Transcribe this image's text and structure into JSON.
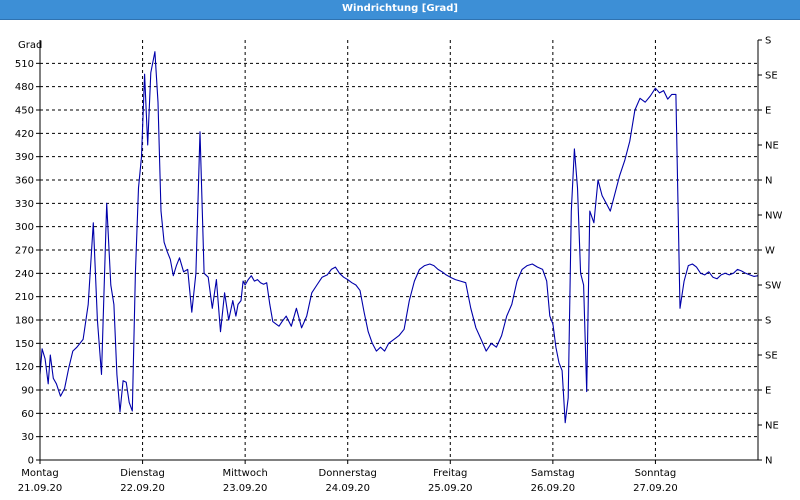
{
  "window": {
    "title": "Windrichtung [Grad]"
  },
  "chart_data": {
    "type": "line",
    "title": "Windrichtung [Grad]",
    "ylabel": "Grad",
    "ylim": [
      0,
      540
    ],
    "xlim": [
      0,
      7
    ],
    "grid": true,
    "y_ticks": [
      0,
      30,
      60,
      90,
      120,
      150,
      180,
      210,
      240,
      270,
      300,
      330,
      360,
      390,
      420,
      450,
      480,
      510
    ],
    "right_ticks": [
      {
        "v": 0,
        "label": "N"
      },
      {
        "v": 45,
        "label": "NE"
      },
      {
        "v": 90,
        "label": "E"
      },
      {
        "v": 135,
        "label": "SE"
      },
      {
        "v": 180,
        "label": "S"
      },
      {
        "v": 225,
        "label": "SW"
      },
      {
        "v": 270,
        "label": "W"
      },
      {
        "v": 315,
        "label": "NW"
      },
      {
        "v": 360,
        "label": "N"
      },
      {
        "v": 405,
        "label": "NE"
      },
      {
        "v": 450,
        "label": "E"
      },
      {
        "v": 495,
        "label": "SE"
      },
      {
        "v": 540,
        "label": "S"
      }
    ],
    "x_ticks": [
      {
        "day": "Montag",
        "date": "21.09.20",
        "x": 0
      },
      {
        "day": "Dienstag",
        "date": "22.09.20",
        "x": 1
      },
      {
        "day": "Mittwoch",
        "date": "23.09.20",
        "x": 2
      },
      {
        "day": "Donnerstag",
        "date": "24.09.20",
        "x": 3
      },
      {
        "day": "Freitag",
        "date": "25.09.20",
        "x": 4
      },
      {
        "day": "Samstag",
        "date": "26.09.20",
        "x": 5
      },
      {
        "day": "Sonntag",
        "date": "27.09.20",
        "x": 6
      }
    ],
    "colors": {
      "line": "#0000aa",
      "grid": "#000000",
      "axis": "#000000"
    },
    "series": [
      {
        "x": [
          0.0,
          0.02,
          0.05,
          0.08,
          0.1,
          0.13,
          0.16,
          0.2,
          0.24,
          0.28,
          0.32,
          0.36,
          0.42,
          0.47,
          0.52,
          0.56,
          0.6,
          0.65,
          0.69,
          0.72,
          0.75,
          0.78,
          0.81,
          0.84,
          0.87,
          0.9,
          0.93,
          0.96,
          0.99,
          1.02,
          1.05,
          1.08,
          1.12,
          1.15,
          1.18,
          1.21,
          1.24,
          1.27,
          1.3,
          1.33,
          1.36,
          1.4,
          1.44,
          1.48,
          1.52,
          1.56,
          1.6,
          1.64,
          1.68,
          1.72,
          1.76,
          1.8,
          1.84,
          1.88,
          1.91,
          1.93,
          1.96,
          1.98,
          2.0,
          2.03,
          2.06,
          2.09,
          2.12,
          2.15,
          2.18,
          2.21,
          2.24,
          2.27,
          2.3,
          2.33,
          2.36,
          2.4,
          2.45,
          2.5,
          2.55,
          2.6,
          2.65,
          2.7,
          2.75,
          2.8,
          2.84,
          2.88,
          2.92,
          2.96,
          3.0,
          3.04,
          3.08,
          3.12,
          3.16,
          3.2,
          3.24,
          3.28,
          3.32,
          3.36,
          3.4,
          3.45,
          3.5,
          3.55,
          3.6,
          3.65,
          3.7,
          3.75,
          3.8,
          3.84,
          3.88,
          3.92,
          3.96,
          4.0,
          4.05,
          4.1,
          4.15,
          4.2,
          4.25,
          4.3,
          4.35,
          4.4,
          4.45,
          4.5,
          4.55,
          4.6,
          4.65,
          4.7,
          4.75,
          4.8,
          4.85,
          4.9,
          4.94,
          4.97,
          5.0,
          5.03,
          5.06,
          5.09,
          5.12,
          5.15,
          5.18,
          5.21,
          5.24,
          5.27,
          5.3,
          5.33,
          5.36,
          5.4,
          5.44,
          5.48,
          5.52,
          5.56,
          5.6,
          5.65,
          5.7,
          5.75,
          5.8,
          5.85,
          5.9,
          5.95,
          6.0,
          6.04,
          6.08,
          6.12,
          6.16,
          6.2,
          6.24,
          6.28,
          6.32,
          6.36,
          6.4,
          6.44,
          6.48,
          6.52,
          6.56,
          6.6,
          6.64,
          6.68,
          6.72,
          6.76,
          6.8,
          6.84,
          6.88,
          6.92,
          6.96,
          7.0
        ],
        "values": [
          110,
          143,
          130,
          98,
          135,
          105,
          98,
          82,
          92,
          118,
          140,
          145,
          155,
          200,
          305,
          180,
          110,
          330,
          225,
          200,
          110,
          62,
          102,
          100,
          74,
          63,
          240,
          350,
          390,
          496,
          405,
          498,
          525,
          460,
          320,
          280,
          268,
          258,
          237,
          250,
          260,
          242,
          245,
          190,
          240,
          422,
          240,
          235,
          195,
          232,
          165,
          215,
          180,
          205,
          185,
          200,
          205,
          230,
          225,
          232,
          237,
          230,
          232,
          228,
          226,
          228,
          200,
          178,
          175,
          172,
          178,
          185,
          172,
          195,
          170,
          185,
          215,
          225,
          235,
          238,
          245,
          248,
          240,
          235,
          232,
          228,
          225,
          218,
          190,
          165,
          150,
          140,
          145,
          140,
          150,
          155,
          160,
          168,
          205,
          230,
          245,
          250,
          252,
          250,
          245,
          242,
          238,
          235,
          232,
          230,
          228,
          195,
          170,
          155,
          140,
          150,
          145,
          160,
          185,
          200,
          230,
          245,
          250,
          252,
          248,
          245,
          230,
          185,
          175,
          145,
          125,
          115,
          48,
          80,
          320,
          400,
          350,
          240,
          225,
          88,
          320,
          305,
          360,
          340,
          330,
          320,
          340,
          365,
          385,
          410,
          450,
          465,
          460,
          468,
          478,
          472,
          475,
          464,
          470,
          470,
          195,
          230,
          250,
          252,
          248,
          240,
          238,
          242,
          235,
          233,
          238,
          240,
          238,
          240,
          245,
          243,
          240,
          238,
          236,
          237
        ]
      }
    ]
  }
}
